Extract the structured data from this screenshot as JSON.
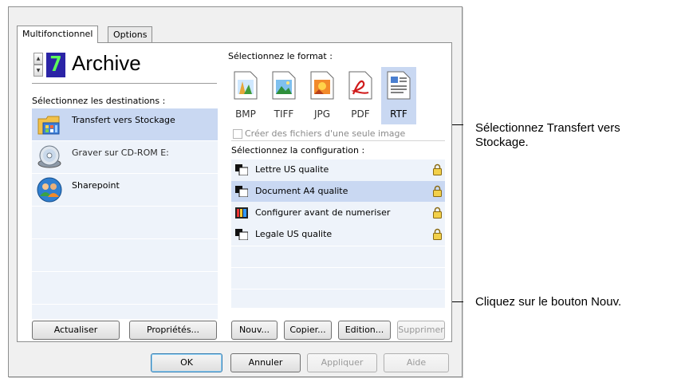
{
  "tabs": [
    {
      "label": "Multifonctionnel",
      "active": true
    },
    {
      "label": "Options",
      "active": false
    }
  ],
  "profile": {
    "number": "7",
    "name": "Archive"
  },
  "destinations": {
    "label": "Sélectionnez les destinations :",
    "items": [
      {
        "label": "Transfert vers Stockage",
        "icon": "storage-transfer-icon",
        "selected": true
      },
      {
        "label": "Graver sur CD-ROM  E:",
        "icon": "cd-rom-icon",
        "selected": false
      },
      {
        "label": "Sharepoint",
        "icon": "sharepoint-icon",
        "selected": false
      }
    ]
  },
  "format": {
    "label": "Sélectionnez le format :",
    "items": [
      {
        "label": "BMP",
        "icon": "bmp-icon",
        "selected": false
      },
      {
        "label": "TIFF",
        "icon": "tiff-icon",
        "selected": false
      },
      {
        "label": "JPG",
        "icon": "jpg-icon",
        "selected": false
      },
      {
        "label": "PDF",
        "icon": "pdf-icon",
        "selected": false
      },
      {
        "label": "RTF",
        "icon": "rtf-icon",
        "selected": true
      }
    ],
    "single_image_checkbox": {
      "label": "Créer des fichiers d'une seule image",
      "checked": false,
      "enabled": false
    }
  },
  "configuration": {
    "label": "Sélectionnez la configuration :",
    "items": [
      {
        "label": "Lettre US qualite",
        "icon": "scanner-config-icon",
        "locked": true,
        "selected": false
      },
      {
        "label": "Document A4 qualite",
        "icon": "scanner-config-icon",
        "locked": true,
        "selected": true
      },
      {
        "label": "Configurer avant de numeriser",
        "icon": "configure-before-scan-icon",
        "locked": true,
        "selected": false
      },
      {
        "label": "Legale US qualite",
        "icon": "scanner-config-icon",
        "locked": true,
        "selected": false
      }
    ]
  },
  "buttons": {
    "refresh": "Actualiser",
    "properties": "Propriétés...",
    "new": "Nouv...",
    "copy": "Copier...",
    "edit": "Edition...",
    "delete": "Supprimer",
    "ok": "OK",
    "cancel": "Annuler",
    "apply": "Appliquer",
    "help": "Aide"
  },
  "callouts": {
    "select_transfer": "Sélectionnez Transfert vers Stockage.",
    "click_new": "Cliquez sur le bouton Nouv."
  },
  "colors": {
    "selection": "#c9d8f2",
    "list_background": "#eef3fa",
    "profile_number_bg": "#2b24a6",
    "profile_number_fg": "#5dff5a"
  }
}
